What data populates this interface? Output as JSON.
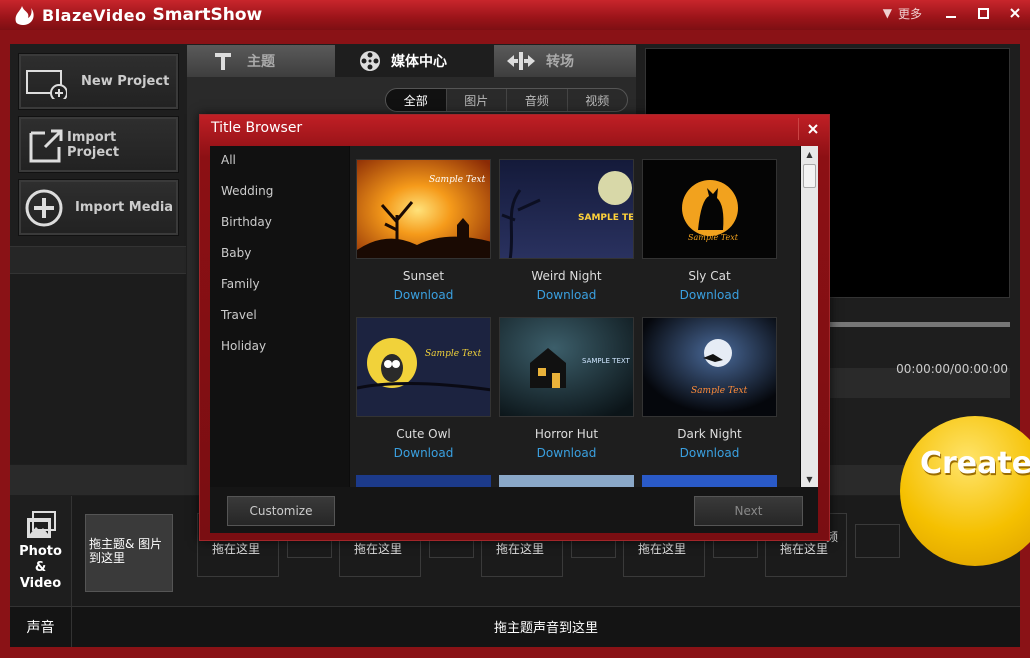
{
  "app": {
    "brand": "BlazeVideo",
    "product": "SmartShow",
    "more_label": "更多"
  },
  "left_buttons": [
    {
      "label": "New Project"
    },
    {
      "label": "Import  Project"
    },
    {
      "label": "Import Media"
    }
  ],
  "tabs": [
    {
      "label": "主题"
    },
    {
      "label": "媒体中心"
    },
    {
      "label": "转场"
    }
  ],
  "filters": [
    "全部",
    "图片",
    "音频",
    "视频"
  ],
  "preview": {
    "timecode": "00:00:00/00:00:00"
  },
  "create_label": "Create",
  "storyboard": {
    "section_label": "Photo\n&\nVideo",
    "first_slot": "拖主题& 图片到这里",
    "slot_label": "拖在这里",
    "audio_label": "声音",
    "audio_drop": "拖主题声音到这里",
    "partial_text": "频"
  },
  "dialog": {
    "title": "Title Browser",
    "categories": [
      "All",
      "Wedding",
      "Birthday",
      "Baby",
      "Family",
      "Travel",
      "Holiday"
    ],
    "download_label": "Download",
    "items": [
      {
        "name": "Sunset",
        "sample_text": "Sample Text"
      },
      {
        "name": "Weird Night",
        "sample_text": "SAMPLE TEXT"
      },
      {
        "name": "Sly Cat",
        "sample_text": "Sample Text"
      },
      {
        "name": "Cute Owl",
        "sample_text": "Sample Text"
      },
      {
        "name": "Horror Hut",
        "sample_text": "SAMPLE TEXT"
      },
      {
        "name": "Dark Night",
        "sample_text": "Sample Text"
      }
    ],
    "customize_label": "Customize",
    "next_label": "Next"
  },
  "colors": {
    "accent_red": "#9a1419",
    "link_blue": "#3aa0e0",
    "create_yellow": "#f5c000"
  }
}
